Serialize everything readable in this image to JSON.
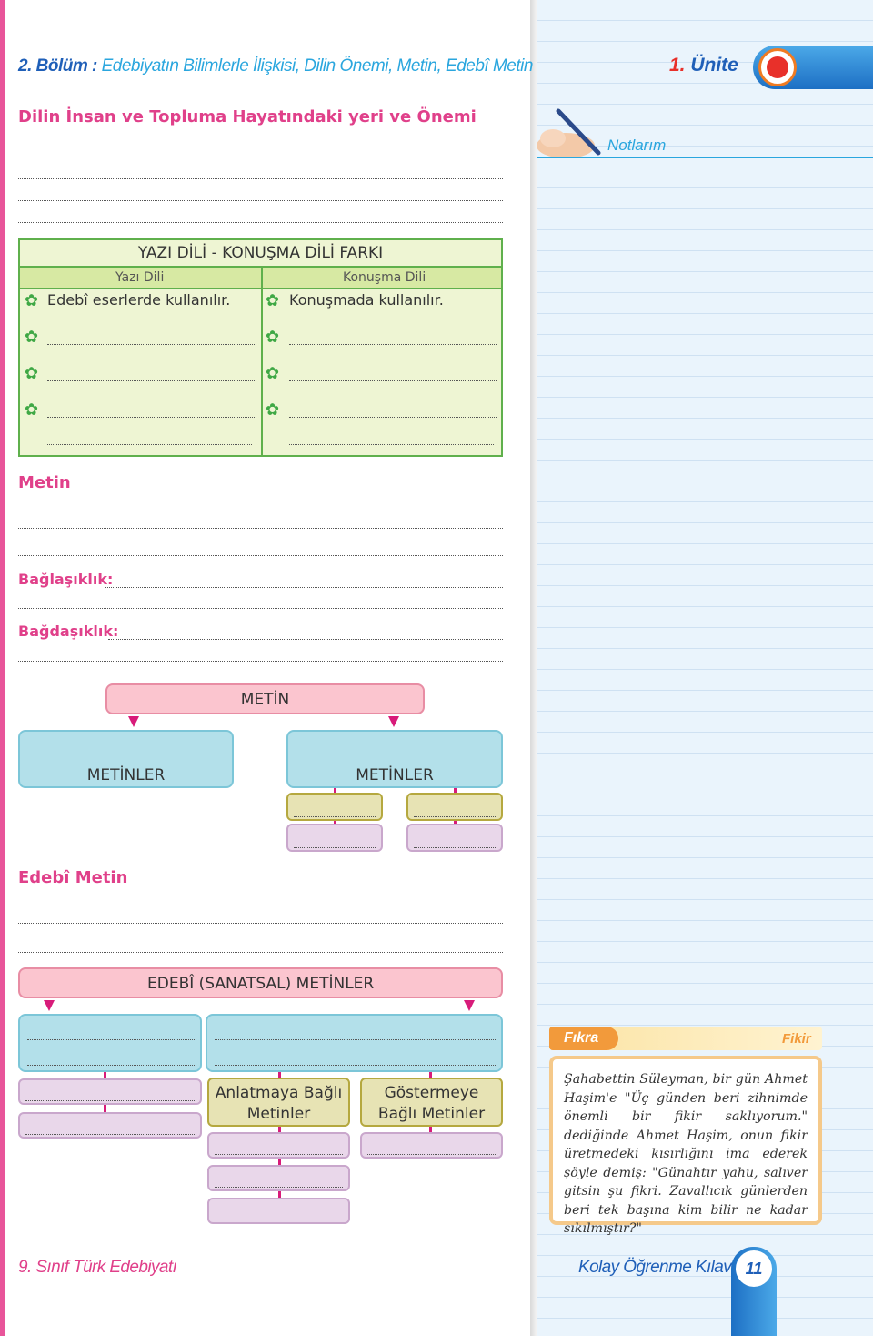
{
  "header": {
    "chapter": "2. Bölüm :",
    "topic": "Edebiyatın Bilimlerle İlişkisi, Dilin Önemi, Metin, Edebî Metin",
    "unit_number": "1.",
    "unit_word": "Ünite"
  },
  "notes": {
    "label": "Notlarım"
  },
  "sections": {
    "language": "Dilin İnsan ve Topluma Hayatındaki yeri ve Önemi",
    "text": "Metin",
    "coherence": "Bağlaşıklık:",
    "cohesion": "Bağdaşıklık:",
    "literary": "Edebî Metin"
  },
  "comparison_table": {
    "title": "YAZI DİLİ - KONUŞMA DİLİ FARKI",
    "col_left": "Yazı Dili",
    "col_right": "Konuşma Dili",
    "row_left": "Edebî eserlerde kullanılır.",
    "row_right": "Konuşmada kullanılır."
  },
  "metin_diagram": {
    "root": "METİN",
    "left_child": "METİNLER",
    "right_child": "METİNLER"
  },
  "literary_diagram": {
    "root": "EDEBÎ (SANATSAL) METİNLER",
    "narrative": "Anlatmaya Bağlı Metinler",
    "dramatic": "Göstermeye Bağlı Metinler"
  },
  "joke": {
    "tab": "Fıkra",
    "tag": "Fikir",
    "text": "Şahabettin Süleyman, bir gün Ahmet Haşim'e \"Üç günden beri zihnimde önemli bir fikir saklıyorum.\" dediğinde Ahmet Haşim, onun fikir üretmedeki kısırlığını ima ederek şöyle demiş: \"Günahtır yahu, salıver gitsin şu fikri. Zavallıcık günlerden beri tek başına kim bilir ne kadar sıkılmıştır?\""
  },
  "footer": {
    "book": "9. Sınıf Türk Edebiyatı",
    "guide": "Kolay Öğrenme Kılavuzu",
    "page": "11"
  },
  "colors": {
    "pink_accent": "#e0408a",
    "blue_accent": "#1f5fb8",
    "table_green": "#5fb04c"
  }
}
